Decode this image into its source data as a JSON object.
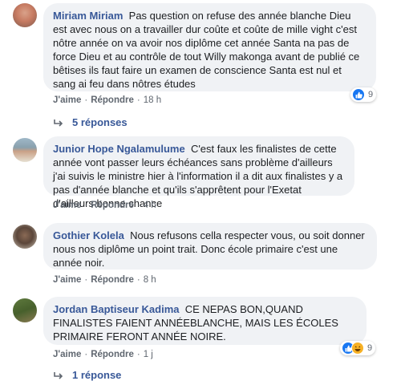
{
  "comments": [
    {
      "author": "Miriam Miriam",
      "text": "Pas question on refuse des année blanche Dieu est avec nous on a travailler dur coûte et coûte de mille vight c'est nôtre année on va avoir nos diplôme cet année Santa na pas de force Dieu et au contrôle de tout Willy makonga avant de publié ce bêtises ils faut faire un examen de conscience Santa est nul et sang ai feu dans nôtres études",
      "like_label": "J'aime",
      "reply_label": "Répondre",
      "time": "18 h",
      "reaction_count": "9",
      "reactions": [
        "like-icon"
      ],
      "replies_label": "5 réponses"
    },
    {
      "author": "Junior Hope Ngalamulume",
      "text": "C'est faux les finalistes de cette année vont passer leurs échéances sans problème d'ailleurs j'ai suivis le ministre hier à l'information il a dit aux finalistes y a pas d'année blanche et qu'ils s'apprêtent pour l'Exetat d'ailleurs bonne chance",
      "like_label": "J'aime",
      "reply_label": "Répondre",
      "time": "4 h"
    },
    {
      "author": "Gothier Kolela",
      "text": "Nous refusons cella respecter vous, ou soit donner nous nos diplôme un point trait. Donc école primaire c'est une année noir.",
      "like_label": "J'aime",
      "reply_label": "Répondre",
      "time": "8 h"
    },
    {
      "author": "Jordan Baptiseur Kadima",
      "text": "CE NEPAS BON,QUAND FINALISTES FAIENT ANNÉEBLANCHE, MAIS LES ÉCOLES PRIMAIRE FERONT ANNÉE NOIRE.",
      "like_label": "J'aime",
      "reply_label": "Répondre",
      "time": "1 j",
      "reaction_count": "9",
      "reactions": [
        "like-icon",
        "haha-icon"
      ],
      "replies_label": "1 réponse"
    }
  ],
  "colors": {
    "name": "#385898",
    "bubble": "#f0f2f5",
    "meta": "#606770",
    "like": "#1877f2",
    "haha": "#f7b125"
  }
}
